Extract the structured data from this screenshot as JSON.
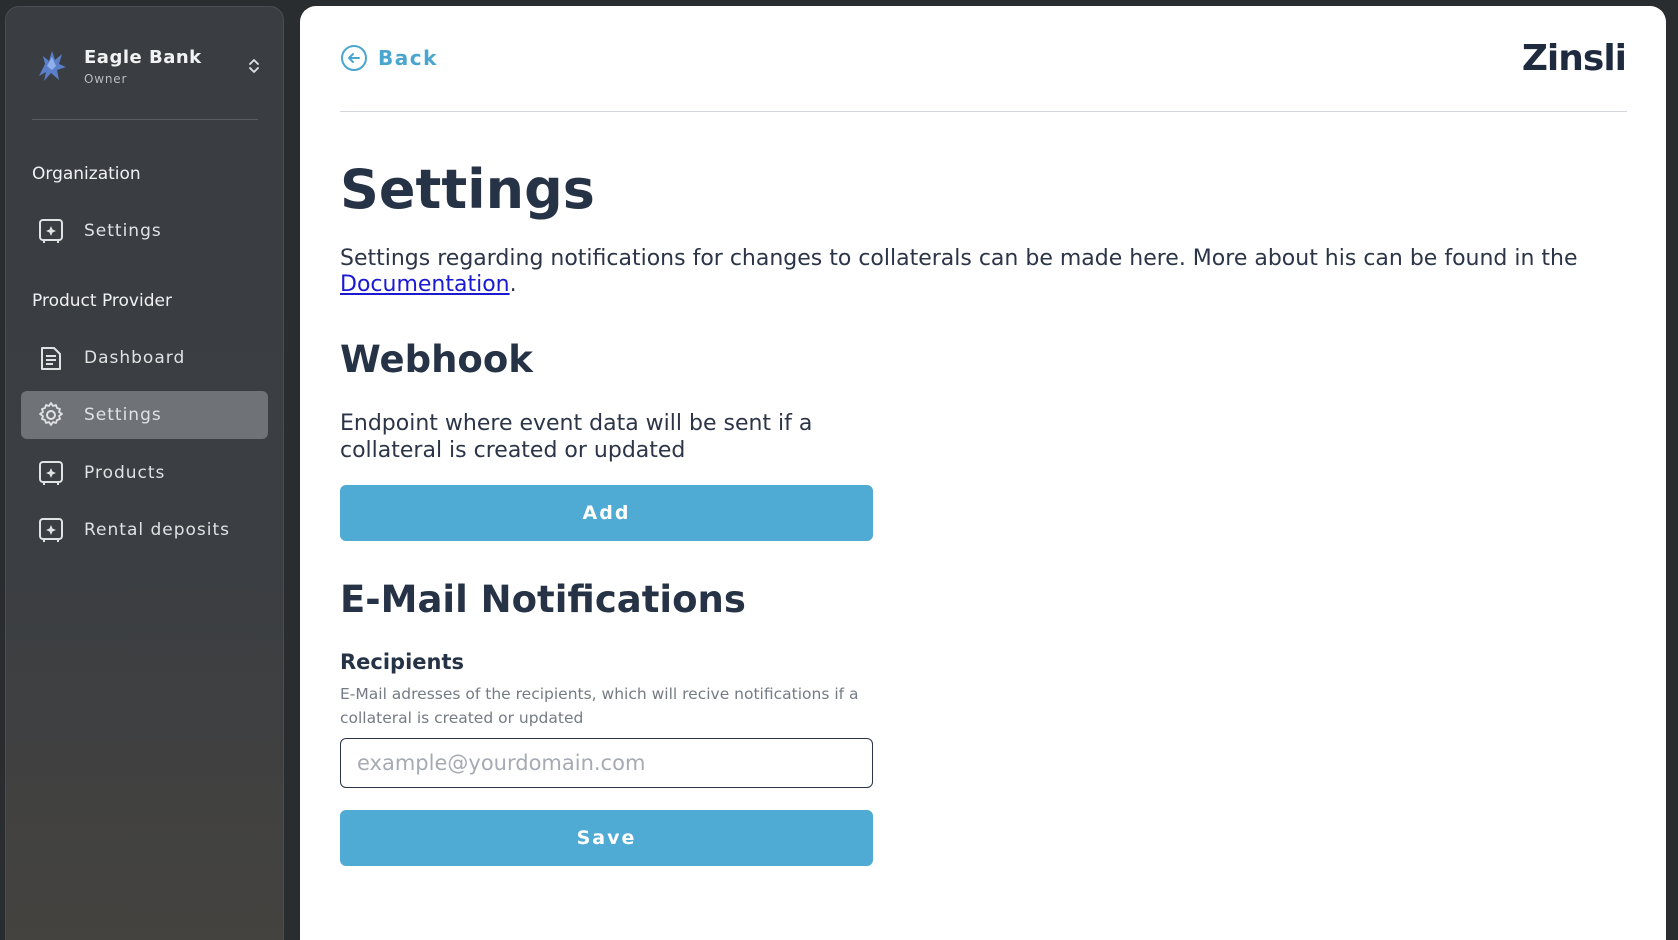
{
  "org": {
    "name": "Eagle Bank",
    "role": "Owner",
    "logo_icon": "eagle-logo-icon",
    "switch_icon": "chevron-updown-icon"
  },
  "sidebar": {
    "sections": [
      {
        "heading": "Organization",
        "items": [
          {
            "label": "Settings",
            "icon": "safe-icon",
            "active": false
          }
        ]
      },
      {
        "heading": "Product Provider",
        "items": [
          {
            "label": "Dashboard",
            "icon": "document-icon",
            "active": false
          },
          {
            "label": "Settings",
            "icon": "gear-icon",
            "active": true
          },
          {
            "label": "Products",
            "icon": "safe-icon",
            "active": false
          },
          {
            "label": "Rental deposits",
            "icon": "safe-icon",
            "active": false
          }
        ]
      }
    ]
  },
  "header": {
    "back_label": "Back",
    "brand": "Zinsli"
  },
  "main": {
    "title": "Settings",
    "intro_text": "Settings regarding notifications for changes to collaterals can be made here. More about his can be found in the ",
    "intro_link": "Documentation",
    "intro_end": ".",
    "webhook": {
      "heading": "Webhook",
      "description": "Endpoint where event data will be sent if a collateral is created or updated",
      "add_label": "Add"
    },
    "email": {
      "heading": "E-Mail Notifications",
      "recipients_label": "Recipients",
      "recipients_help": "E-Mail adresses of the recipients, which will recive notifications if a collateral is created or updated",
      "placeholder": "example@yourdomain.com",
      "value": "",
      "save_label": "Save"
    }
  },
  "colors": {
    "accent": "#4fabd4",
    "link": "#1a1ad0",
    "heading": "#263245",
    "sidebar_active": "#6f7276"
  }
}
